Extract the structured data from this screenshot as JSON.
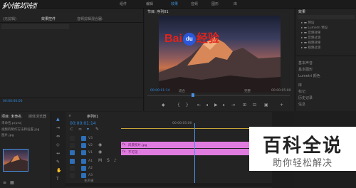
{
  "watermark_top": "秒懂视频",
  "menubar": {
    "items": [
      "组件",
      "编辑",
      "效果",
      "音频",
      "图形",
      "库"
    ]
  },
  "source_panel": {
    "title": "(无剪辑)",
    "tab_effect_controls": "效果控件",
    "tab_audio_mixer": "音频剪辑混合器:",
    "time": "00:00:00:00"
  },
  "program_panel": {
    "title": "节目: 序列01",
    "timecode_left": "00:00:01:14",
    "fit_label": "适合",
    "quality_label": "完整",
    "timecode_right": "00:00:05:00"
  },
  "video_overlay": {
    "baidu_left": "Bai",
    "baidu_paw": "du",
    "baidu_right": "经验"
  },
  "effects_panel": {
    "title": "效果",
    "items": [
      "预设",
      "Lumetri 预设",
      "音频效果",
      "音频过渡",
      "视频效果",
      "视频过渡"
    ],
    "sections": [
      "基本声音",
      "基本图形",
      "Lumetri 颜色",
      "库",
      "标记",
      "历史记录",
      "信息"
    ]
  },
  "project_panel": {
    "title": "项目: 未命名",
    "tab_media": "媒体浏览器",
    "file_row1": "未命名.prproj",
    "file_row2": "视频的制作方法和设置 jpg",
    "file_row3": "图片.jpg"
  },
  "timeline": {
    "tab": "序列01",
    "timecode": "00:00:01:14",
    "ruler_mark": "00:00:05:00",
    "tracks": [
      "V3",
      "V2",
      "V1",
      "A1",
      "A2",
      "A3"
    ],
    "clip_fx": "fx",
    "clip_v2_label": "风景照片.jpg",
    "clip_v1_label": "不可见",
    "bottom_label": "主声道"
  },
  "logo_overlay": {
    "title": "百科全说",
    "subtitle": "助你轻松解决"
  },
  "colors": {
    "accent": "#2f8ae0",
    "clip": "#e07be0",
    "playhead": "#4a90e2"
  }
}
